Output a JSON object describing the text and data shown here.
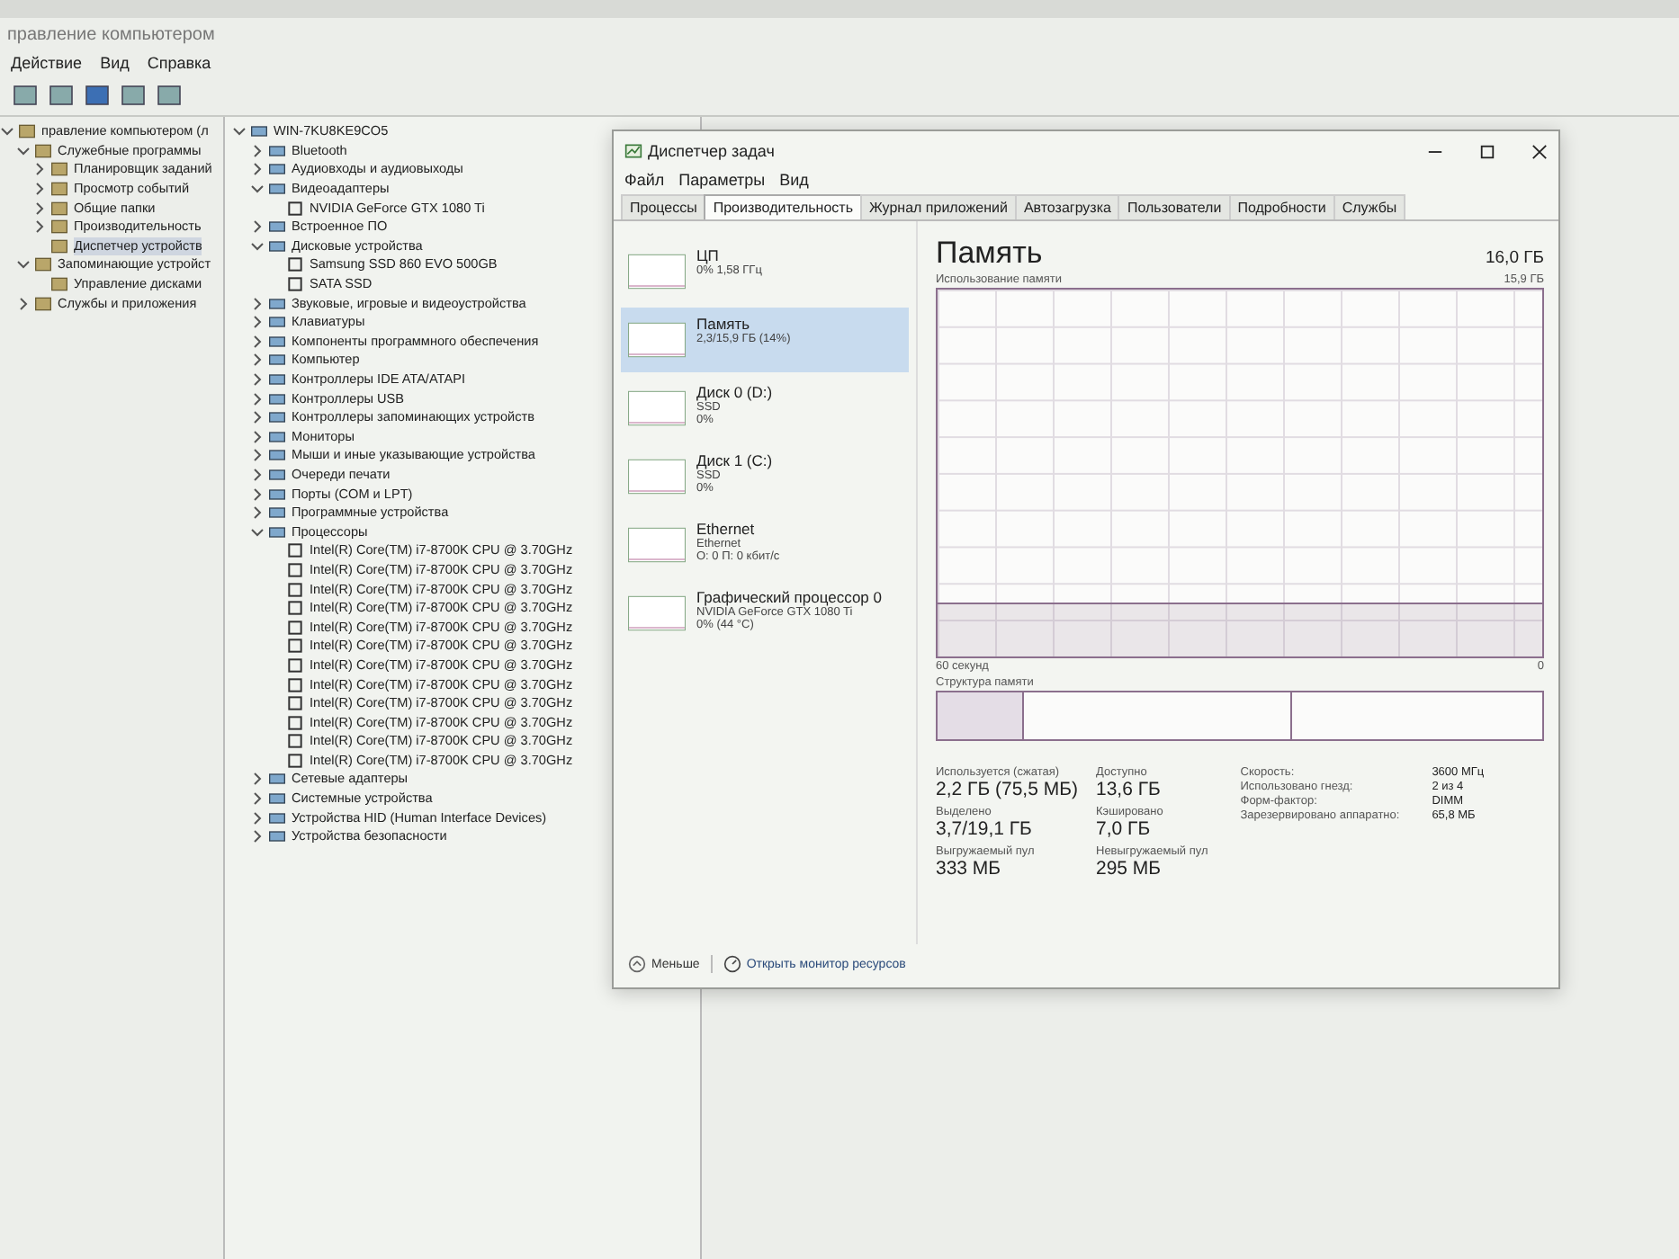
{
  "mmc": {
    "title": "правление компьютером",
    "menu": [
      "Действие",
      "Вид",
      "Справка"
    ],
    "nav": [
      {
        "label": "правление компьютером (л",
        "expanded": true,
        "selected": false,
        "children": [
          {
            "label": "Служебные программы",
            "expanded": true,
            "selected": false,
            "children": [
              {
                "label": "Планировщик заданий",
                "expanded": false,
                "selected": false
              },
              {
                "label": "Просмотр событий",
                "expanded": false,
                "selected": false
              },
              {
                "label": "Общие папки",
                "expanded": false,
                "selected": false
              },
              {
                "label": "Производительность",
                "expanded": false,
                "selected": false
              },
              {
                "label": "Диспетчер устройств",
                "selected": true
              }
            ]
          },
          {
            "label": "Запоминающие устройст",
            "expanded": true,
            "selected": false,
            "children": [
              {
                "label": "Управление дисками",
                "selected": false
              }
            ]
          },
          {
            "label": "Службы и приложения",
            "expanded": false,
            "selected": false
          }
        ]
      }
    ],
    "devices": [
      {
        "label": "WIN-7KU8KE9CO5",
        "expanded": true,
        "children": [
          {
            "label": "Bluetooth",
            "expanded": false
          },
          {
            "label": "Аудиовходы и аудиовыходы",
            "expanded": false
          },
          {
            "label": "Видеоадаптеры",
            "expanded": true,
            "children": [
              {
                "label": "NVIDIA GeForce GTX 1080 Ti"
              }
            ]
          },
          {
            "label": "Встроенное ПО",
            "expanded": false
          },
          {
            "label": "Дисковые устройства",
            "expanded": true,
            "children": [
              {
                "label": "Samsung SSD 860 EVO 500GB"
              },
              {
                "label": "SATA SSD"
              }
            ]
          },
          {
            "label": "Звуковые, игровые и видеоустройства",
            "expanded": false
          },
          {
            "label": "Клавиатуры",
            "expanded": false
          },
          {
            "label": "Компоненты программного обеспечения",
            "expanded": false
          },
          {
            "label": "Компьютер",
            "expanded": false
          },
          {
            "label": "Контроллеры IDE ATA/ATAPI",
            "expanded": false
          },
          {
            "label": "Контроллеры USB",
            "expanded": false
          },
          {
            "label": "Контроллеры запоминающих устройств",
            "expanded": false
          },
          {
            "label": "Мониторы",
            "expanded": false
          },
          {
            "label": "Мыши и иные указывающие устройства",
            "expanded": false
          },
          {
            "label": "Очереди печати",
            "expanded": false
          },
          {
            "label": "Порты (COM и LPT)",
            "expanded": false
          },
          {
            "label": "Программные устройства",
            "expanded": false
          },
          {
            "label": "Процессоры",
            "expanded": true,
            "children": [
              {
                "label": "Intel(R) Core(TM) i7-8700K CPU @ 3.70GHz"
              },
              {
                "label": "Intel(R) Core(TM) i7-8700K CPU @ 3.70GHz"
              },
              {
                "label": "Intel(R) Core(TM) i7-8700K CPU @ 3.70GHz"
              },
              {
                "label": "Intel(R) Core(TM) i7-8700K CPU @ 3.70GHz"
              },
              {
                "label": "Intel(R) Core(TM) i7-8700K CPU @ 3.70GHz"
              },
              {
                "label": "Intel(R) Core(TM) i7-8700K CPU @ 3.70GHz"
              },
              {
                "label": "Intel(R) Core(TM) i7-8700K CPU @ 3.70GHz"
              },
              {
                "label": "Intel(R) Core(TM) i7-8700K CPU @ 3.70GHz"
              },
              {
                "label": "Intel(R) Core(TM) i7-8700K CPU @ 3.70GHz"
              },
              {
                "label": "Intel(R) Core(TM) i7-8700K CPU @ 3.70GHz"
              },
              {
                "label": "Intel(R) Core(TM) i7-8700K CPU @ 3.70GHz"
              },
              {
                "label": "Intel(R) Core(TM) i7-8700K CPU @ 3.70GHz"
              }
            ]
          },
          {
            "label": "Сетевые адаптеры",
            "expanded": false
          },
          {
            "label": "Системные устройства",
            "expanded": false
          },
          {
            "label": "Устройства HID (Human Interface Devices)",
            "expanded": false
          },
          {
            "label": "Устройства безопасности",
            "expanded": false
          }
        ]
      }
    ]
  },
  "task_manager": {
    "title": "Диспетчер задач",
    "menu": [
      "Файл",
      "Параметры",
      "Вид"
    ],
    "tabs": [
      {
        "label": "Процессы",
        "selected": false
      },
      {
        "label": "Производительность",
        "selected": true
      },
      {
        "label": "Журнал приложений",
        "selected": false
      },
      {
        "label": "Автозагрузка",
        "selected": false
      },
      {
        "label": "Пользователи",
        "selected": false
      },
      {
        "label": "Подробности",
        "selected": false
      },
      {
        "label": "Службы",
        "selected": false
      }
    ],
    "resources": [
      {
        "name": "ЦП",
        "lines": [
          "0% 1,58 ГГц"
        ],
        "selected": false
      },
      {
        "name": "Память",
        "lines": [
          "2,3/15,9 ГБ (14%)"
        ],
        "selected": true
      },
      {
        "name": "Диск 0 (D:)",
        "lines": [
          "SSD",
          "0%"
        ],
        "selected": false
      },
      {
        "name": "Диск 1 (C:)",
        "lines": [
          "SSD",
          "0%"
        ],
        "selected": false
      },
      {
        "name": "Ethernet",
        "lines": [
          "Ethernet",
          "О: 0 П: 0 кбит/с"
        ],
        "selected": false
      },
      {
        "name": "Графический процессор 0",
        "lines": [
          "NVIDIA GeForce GTX 1080 Ti",
          "0% (44 °C)"
        ],
        "selected": false
      }
    ],
    "detail": {
      "title": "Память",
      "total": "16,0 ГБ",
      "graph_label": "Использование памяти",
      "graph_max": "15,9 ГБ",
      "time_label": "60 секунд",
      "graph_min": "0",
      "composition_label": "Структура памяти",
      "stats": [
        {
          "label": "Используется (сжатая)",
          "value": "2,2 ГБ (75,5 МБ)"
        },
        {
          "label": "Доступно",
          "value": "13,6 ГБ"
        },
        {
          "label": "Выделено",
          "value": "3,7/19,1 ГБ"
        },
        {
          "label": "Кэшировано",
          "value": "7,0 ГБ"
        },
        {
          "label": "Выгружаемый пул",
          "value": "333 МБ"
        },
        {
          "label": "Невыгружаемый пул",
          "value": "295 МБ"
        }
      ],
      "specs": [
        {
          "label": "Скорость:",
          "value": "3600 МГц"
        },
        {
          "label": "Использовано гнезд:",
          "value": "2 из 4"
        },
        {
          "label": "Форм-фактор:",
          "value": "DIMM"
        },
        {
          "label": "Зарезервировано аппаратно:",
          "value": "65,8 МБ"
        }
      ]
    },
    "footer": {
      "less": "Меньше",
      "monitor_link": "Открыть монитор ресурсов"
    }
  }
}
